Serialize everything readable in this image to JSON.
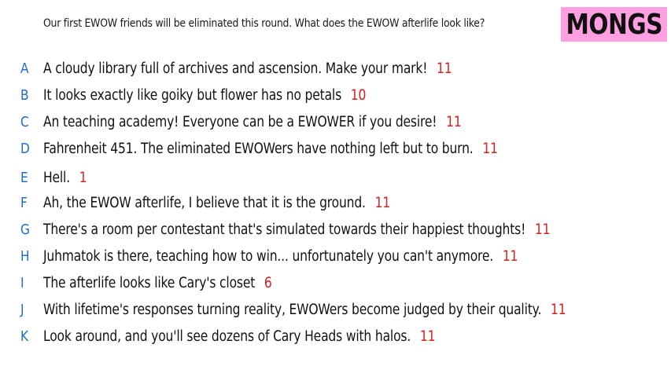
{
  "prompt": "Our first EWOW friends will be eliminated this round. What does the EWOW afterlife look like?",
  "badge": "MONGS",
  "colors": {
    "badge_bg": "#ff9ee0",
    "letter": "#1f6cd0",
    "score": "#d81f1f",
    "text": "#111111"
  },
  "responses": [
    {
      "letter": "A",
      "text": "A cloudy library full of archives and ascension. Make your mark!",
      "score": "11"
    },
    {
      "letter": "B",
      "text": "It looks exactly like goiky but flower has no petals",
      "score": "10"
    },
    {
      "letter": "C",
      "text": "An teaching academy! Everyone can be a EWOWER if you desire!",
      "score": "11"
    },
    {
      "letter": "D",
      "text": "Fahrenheit 451. The eliminated EWOWers have nothing left but to burn.",
      "score": "11"
    },
    {
      "letter": "E",
      "text": "Hell.",
      "score": "1"
    },
    {
      "letter": "F",
      "text": "Ah, the EWOW afterlife, I believe that it is the ground.",
      "score": "11"
    },
    {
      "letter": "G",
      "text": "There's a room per contestant that's simulated towards their happiest thoughts!",
      "score": "11"
    },
    {
      "letter": "H",
      "text": "Juhmatok is there, teaching how to win... unfortunately you can't anymore.",
      "score": "11"
    },
    {
      "letter": "I",
      "text": "The afterlife looks like Cary's closet",
      "score": "6"
    },
    {
      "letter": "J",
      "text": "With lifetime's responses turning reality, EWOWers become judged by their quality.",
      "score": "11"
    },
    {
      "letter": "K",
      "text": "Look around, and you'll see dozens of Cary Heads with halos.",
      "score": "11"
    }
  ]
}
